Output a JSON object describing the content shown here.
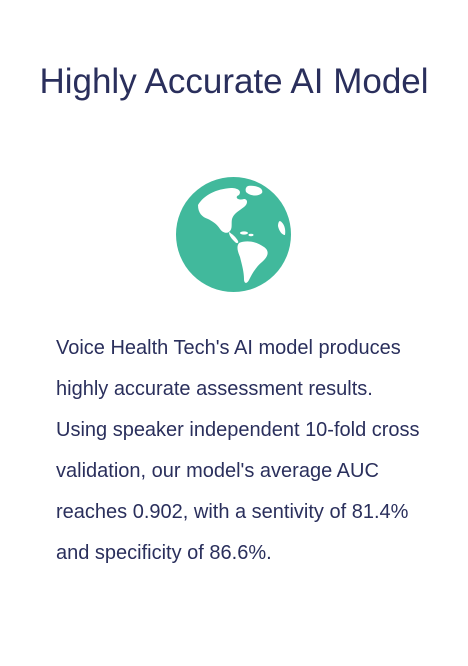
{
  "feature": {
    "title": "Highly Accurate AI Model",
    "icon": "globe-americas-icon",
    "accent_color": "#41b99c",
    "text_color": "#2a2f5c",
    "description": "Voice Health Tech's AI model produces highly accurate assessment results. Using speaker independent 10-fold cross validation, our model's average AUC reaches 0.902, with a sentivity of 81.4% and specificity of 86.6%."
  }
}
